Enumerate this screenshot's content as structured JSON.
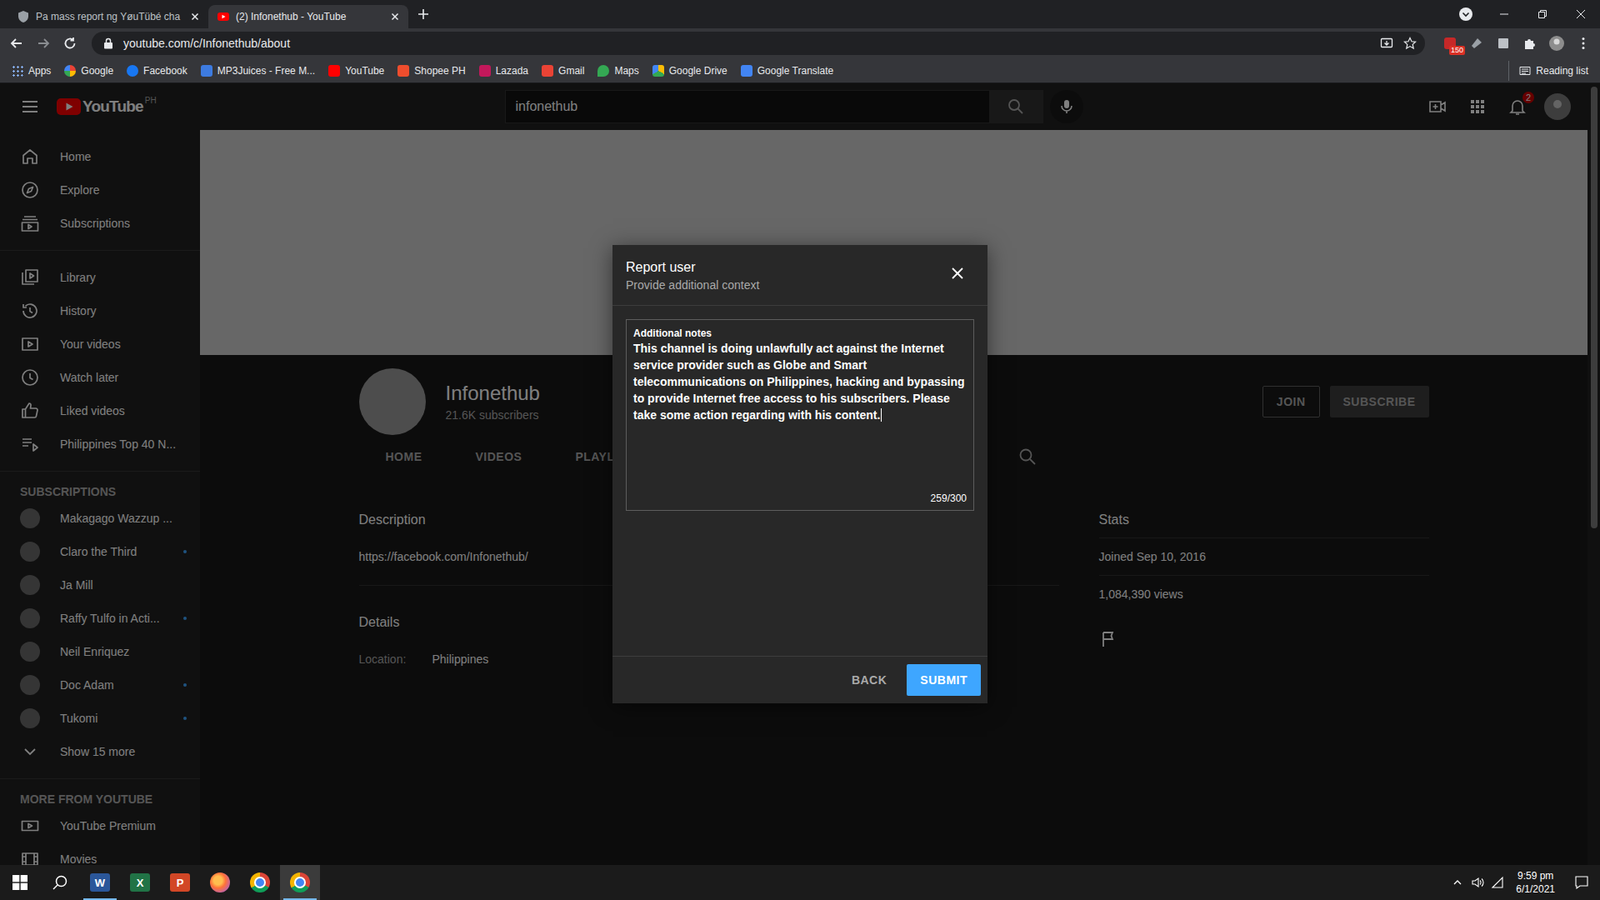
{
  "browser": {
    "tabs": [
      {
        "title": "Pa mass report ng YøuTübé cha",
        "selected": false,
        "kind": "shield"
      },
      {
        "title": "(2) Infonethub - YouTube",
        "selected": true,
        "kind": "youtube"
      }
    ],
    "url": "youtube.com/c/Infonethub/about",
    "extension_badge": "150",
    "bookmarks": [
      {
        "label": "Apps",
        "kind": "apps"
      },
      {
        "label": "Google",
        "kind": "google"
      },
      {
        "label": "Facebook",
        "kind": "facebook"
      },
      {
        "label": "MP3Juices - Free M...",
        "kind": "download"
      },
      {
        "label": "YouTube",
        "kind": "youtube"
      },
      {
        "label": "Shopee PH",
        "kind": "shopee"
      },
      {
        "label": "Lazada",
        "kind": "lazada"
      },
      {
        "label": "Gmail",
        "kind": "gmail"
      },
      {
        "label": "Maps",
        "kind": "maps"
      },
      {
        "label": "Google Drive",
        "kind": "drive"
      },
      {
        "label": "Google Translate",
        "kind": "translate"
      }
    ],
    "reading_list": "Reading list"
  },
  "youtube": {
    "logo": "YouTube",
    "region": "PH",
    "search_query": "infonethub",
    "notifications": "2",
    "sidebar": {
      "main": [
        {
          "label": "Home",
          "kind": "home"
        },
        {
          "label": "Explore",
          "kind": "explore"
        },
        {
          "label": "Subscriptions",
          "kind": "subscriptions"
        }
      ],
      "library": [
        {
          "label": "Library",
          "kind": "library"
        },
        {
          "label": "History",
          "kind": "history"
        },
        {
          "label": "Your videos",
          "kind": "videos"
        },
        {
          "label": "Watch later",
          "kind": "watch"
        },
        {
          "label": "Liked videos",
          "kind": "liked"
        },
        {
          "label": "Philippines Top 40 N...",
          "kind": "playlist"
        }
      ],
      "subscriptions_title": "SUBSCRIPTIONS",
      "subscriptions": [
        {
          "name": "Makagago Wazzup ...",
          "new": false
        },
        {
          "name": "Claro the Third",
          "new": true
        },
        {
          "name": "Ja Mill",
          "new": false
        },
        {
          "name": "Raffy Tulfo in Acti...",
          "new": true
        },
        {
          "name": "Neil Enriquez",
          "new": false
        },
        {
          "name": "Doc Adam",
          "new": true
        },
        {
          "name": "Tukomi",
          "new": true
        }
      ],
      "show_more": "Show 15 more",
      "more_title": "MORE FROM YOUTUBE",
      "more": [
        {
          "label": "YouTube Premium",
          "kind": "premium"
        },
        {
          "label": "Movies",
          "kind": "movies"
        }
      ]
    },
    "channel": {
      "name": "Infonethub",
      "subscribers": "21.6K subscribers",
      "join": "JOIN",
      "subscribe": "SUBSCRIBE",
      "tabs": [
        {
          "label": "HOME",
          "selected": false
        },
        {
          "label": "VIDEOS",
          "selected": false
        },
        {
          "label": "PLAYLI",
          "selected": false
        }
      ]
    },
    "about": {
      "description_title": "Description",
      "description": "https://facebook.com/Infonethub/",
      "details_title": "Details",
      "location_label": "Location:",
      "location": "Philippines",
      "stats_title": "Stats",
      "joined": "Joined Sep 10, 2016",
      "views": "1,084,390 views"
    }
  },
  "dialog": {
    "title": "Report user",
    "subtitle": "Provide additional context",
    "field_label": "Additional notes",
    "notes": "This channel is doing unlawfully act against the Internet service provider such as Globe and Smart telecommunications on Philippines, hacking and bypassing to provide Internet free access to his subscribers. Please take some action regarding with his content.",
    "counter": "259/300",
    "back": "BACK",
    "submit": "SUBMIT"
  },
  "taskbar": {
    "apps": [
      {
        "kind": "word",
        "glyph": "W",
        "open": true,
        "selected": false
      },
      {
        "kind": "excel",
        "glyph": "X",
        "open": false,
        "selected": false
      },
      {
        "kind": "powerpoint",
        "glyph": "P",
        "open": false,
        "selected": false
      },
      {
        "kind": "firefox",
        "open": false,
        "selected": false
      },
      {
        "kind": "chrome",
        "open": false,
        "selected": false
      },
      {
        "kind": "chrome",
        "open": true,
        "selected": true
      }
    ],
    "clock": {
      "time": "9:59 pm",
      "date": "6/1/2021"
    }
  }
}
